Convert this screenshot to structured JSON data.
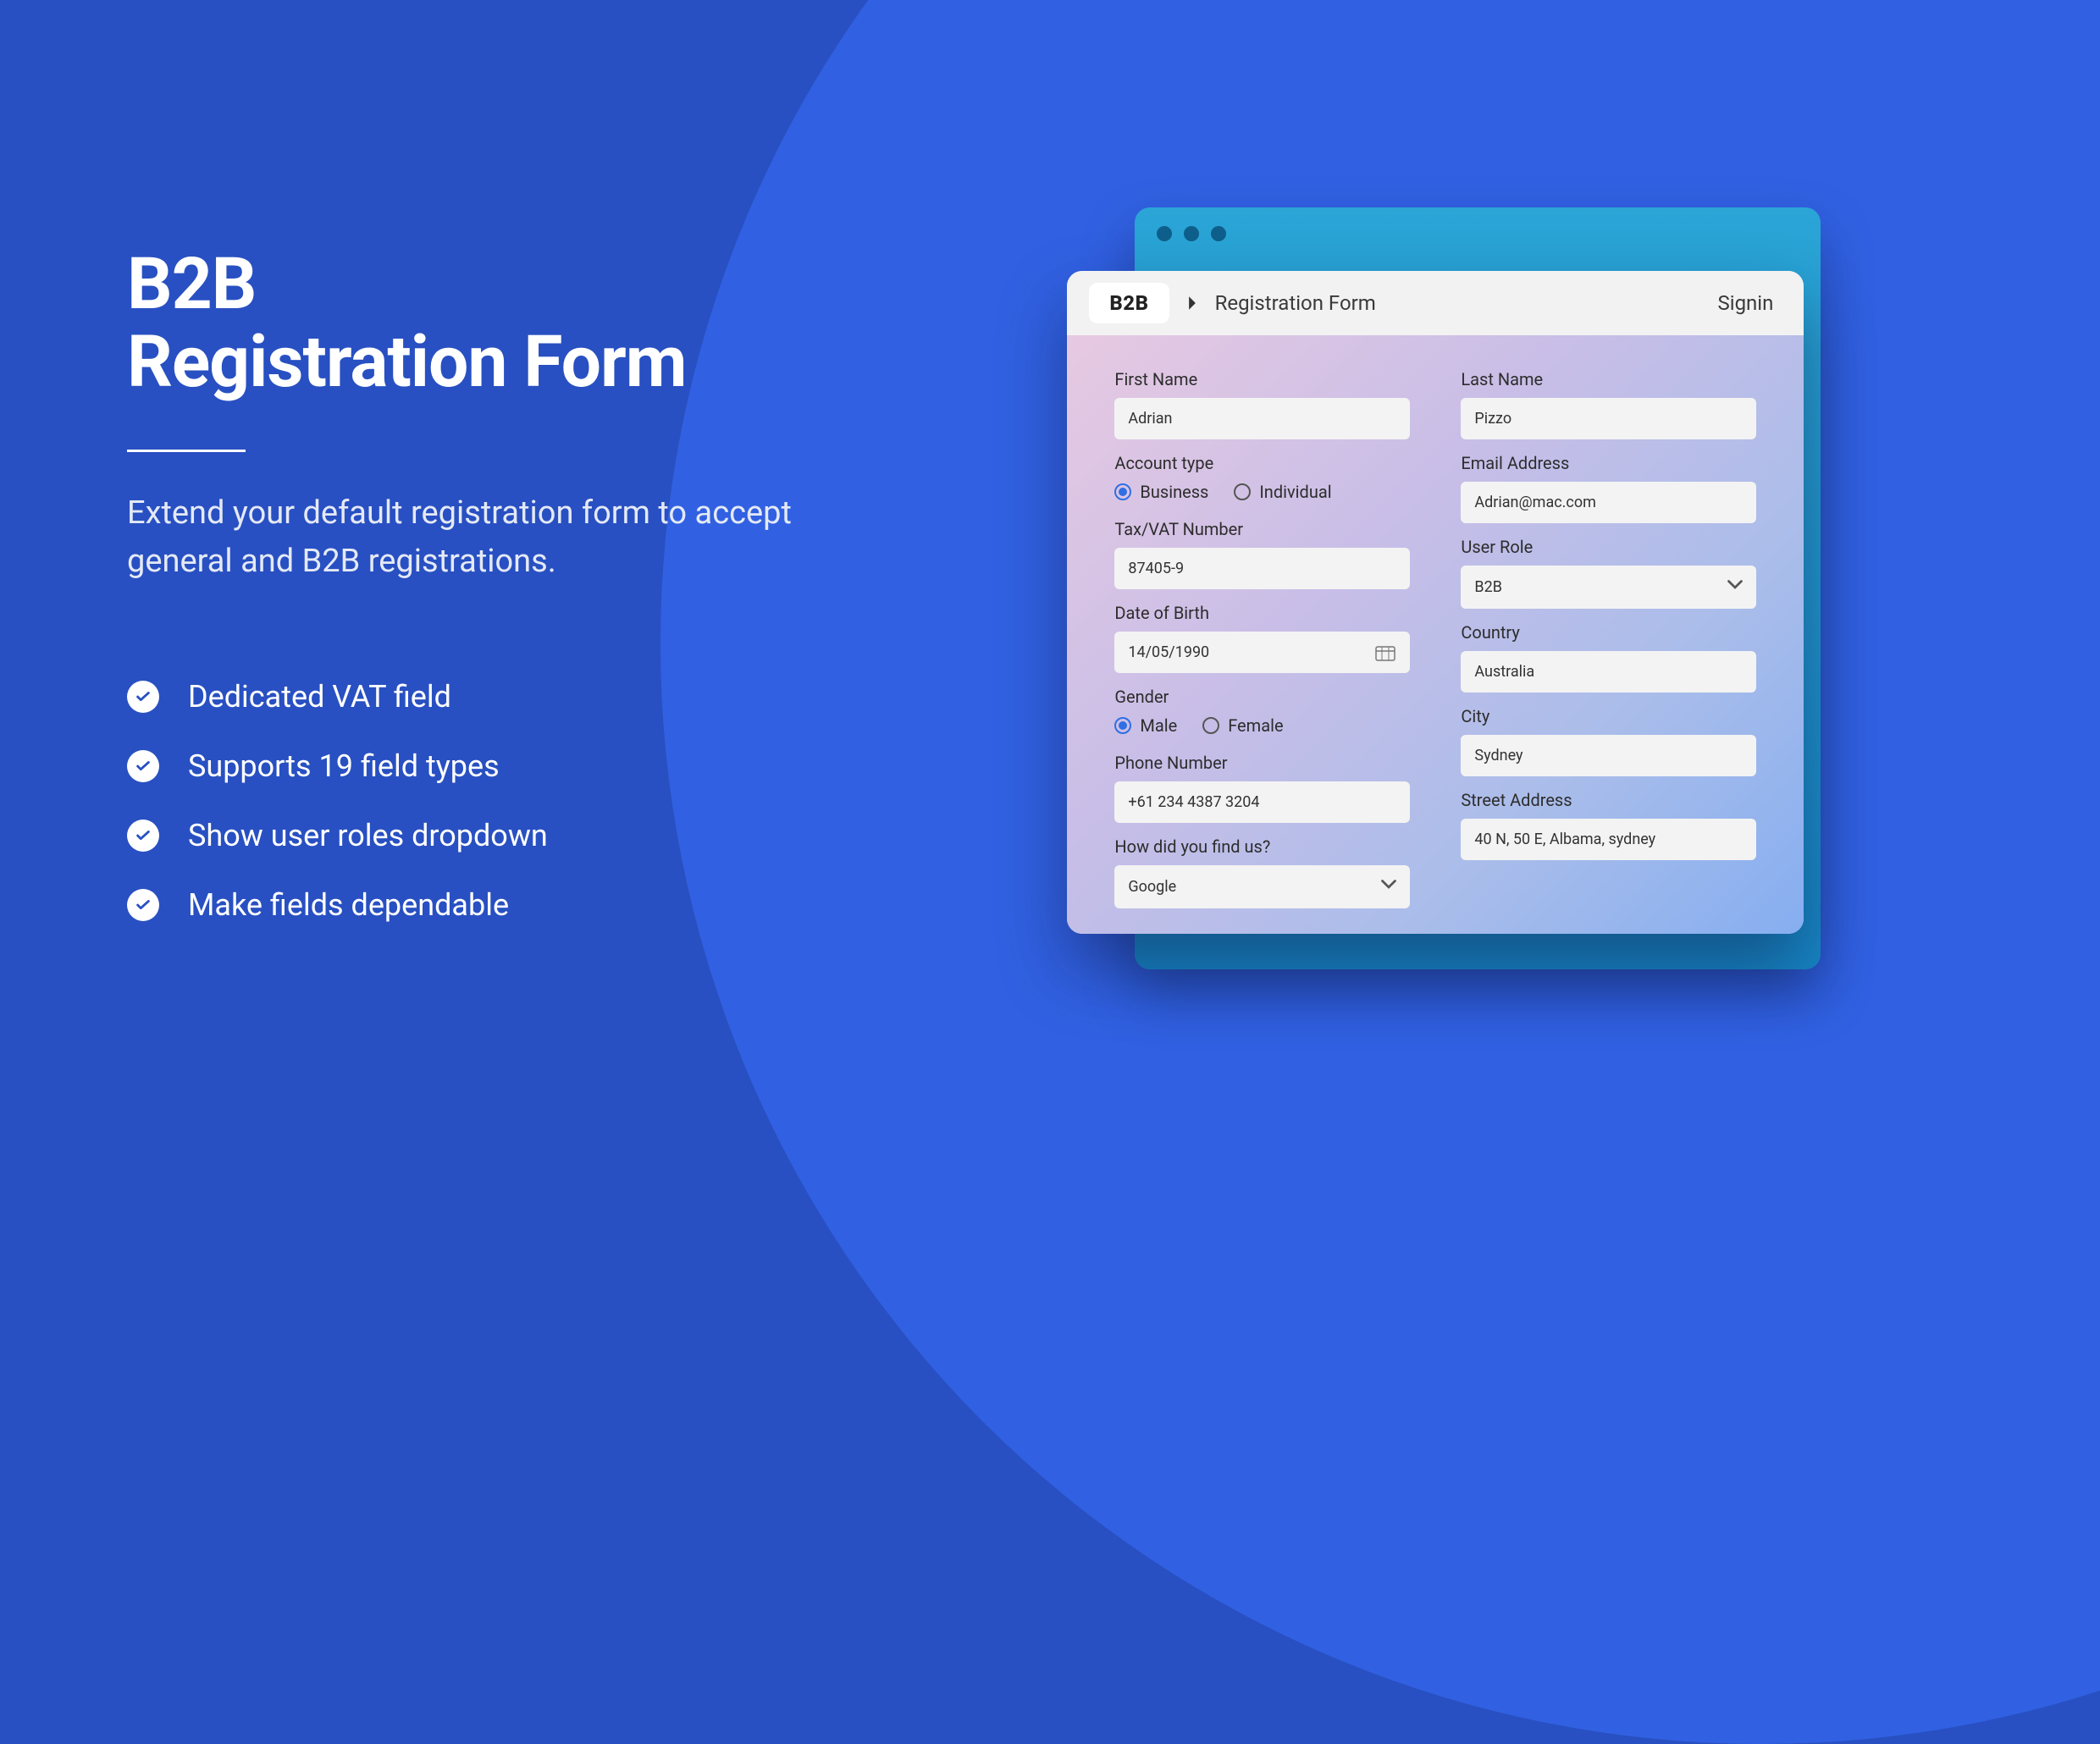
{
  "hero": {
    "title_line1": "B2B",
    "title_line2": "Registration Form",
    "subtitle": "Extend your default registration form to accept general and B2B registrations.",
    "features": [
      "Dedicated VAT field",
      "Supports 19 field types",
      "Show user roles dropdown",
      "Make fields dependable"
    ]
  },
  "window": {
    "chip": "B2B",
    "title": "Registration Form",
    "signin": "Signin"
  },
  "form": {
    "first_name": {
      "label": "First Name",
      "value": "Adrian"
    },
    "last_name": {
      "label": "Last Name",
      "value": "Pizzo"
    },
    "account_type": {
      "label": "Account type",
      "option_business": "Business",
      "option_individual": "Individual",
      "selected": "Business"
    },
    "email": {
      "label": "Email Address",
      "value": "Adrian@mac.com"
    },
    "tax": {
      "label": "Tax/VAT Number",
      "value": "87405-9"
    },
    "user_role": {
      "label": "User Role",
      "value": "B2B"
    },
    "dob": {
      "label": "Date of Birth",
      "value": "14/05/1990"
    },
    "country": {
      "label": "Country",
      "value": "Australia"
    },
    "gender": {
      "label": "Gender",
      "option_male": "Male",
      "option_female": "Female",
      "selected": "Male"
    },
    "city": {
      "label": "City",
      "value": "Sydney"
    },
    "phone": {
      "label": "Phone Number",
      "value": "+61 234 4387 3204"
    },
    "street": {
      "label": "Street Address",
      "value": "40 N, 50 E, Albama, sydney"
    },
    "found_us": {
      "label": "How did you find us?",
      "value": "Google"
    }
  }
}
